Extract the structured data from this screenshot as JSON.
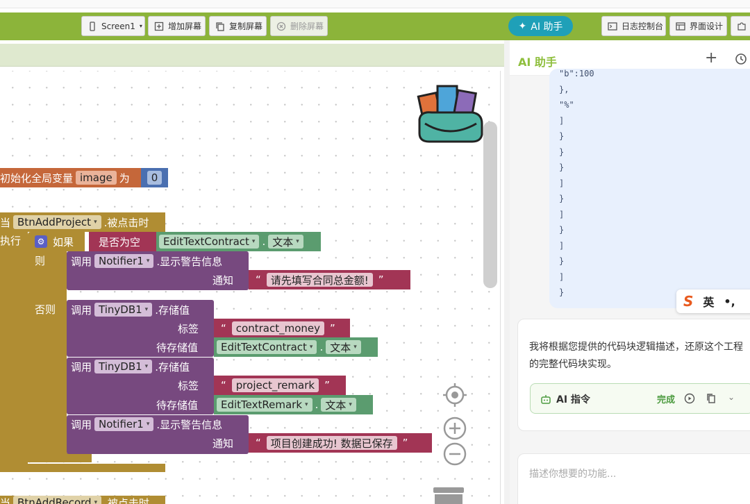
{
  "toolbar": {
    "screen_select": "Screen1",
    "add_screen": "增加屏幕",
    "copy_screen": "复制屏幕",
    "delete_screen": "删除屏幕",
    "ai_button": "AI 助手",
    "log_console": "日志控制台",
    "ui_design": "界面设计",
    "accent_color": "#8cb43a"
  },
  "blocks": {
    "global_init": {
      "prefix": "初始化全局变量",
      "name": "image",
      "as": "为",
      "value": "0"
    },
    "event1": {
      "when": "当",
      "component": "BtnAddProject",
      "event": ".被点击时",
      "do": "执行",
      "if": "如果",
      "is_empty": "是否为空",
      "field1_component": "EditTextContract",
      "dot": ".",
      "field1_prop": "文本",
      "then": "则",
      "else": "否则",
      "call": "调用",
      "notifier": "Notifier1",
      "alert_method": ".显示警告信息",
      "notice": "通知",
      "warning_msg": "请先填写合同总金额!",
      "tinydb": "TinyDB1",
      "store_method": ".存储值",
      "tag": "标签",
      "value_to_store": "待存储值",
      "tag1": "contract_money",
      "tag2": "project_remark",
      "field2_component": "EditTextRemark",
      "success_msg": "项目创建成功! 数据已保存"
    },
    "event2": {
      "when": "当",
      "component": "BtnAddRecord",
      "event": ".被点击时"
    }
  },
  "assistant": {
    "title": "AI 助手",
    "code_lines": [
      "\"b\":100",
      "},",
      "\"%\"",
      "]",
      "}",
      "}",
      "}",
      "]",
      "}",
      "]",
      "}",
      "]",
      "}",
      "]",
      "}"
    ],
    "ime_lang": "英",
    "ime_punct": "•,",
    "message": "我将根据您提供的代码块逻辑描述，还原这个工程的完整代码块实现。",
    "command_label": "AI 指令",
    "command_status": "完成",
    "input_placeholder": "描述你想要的功能..."
  }
}
